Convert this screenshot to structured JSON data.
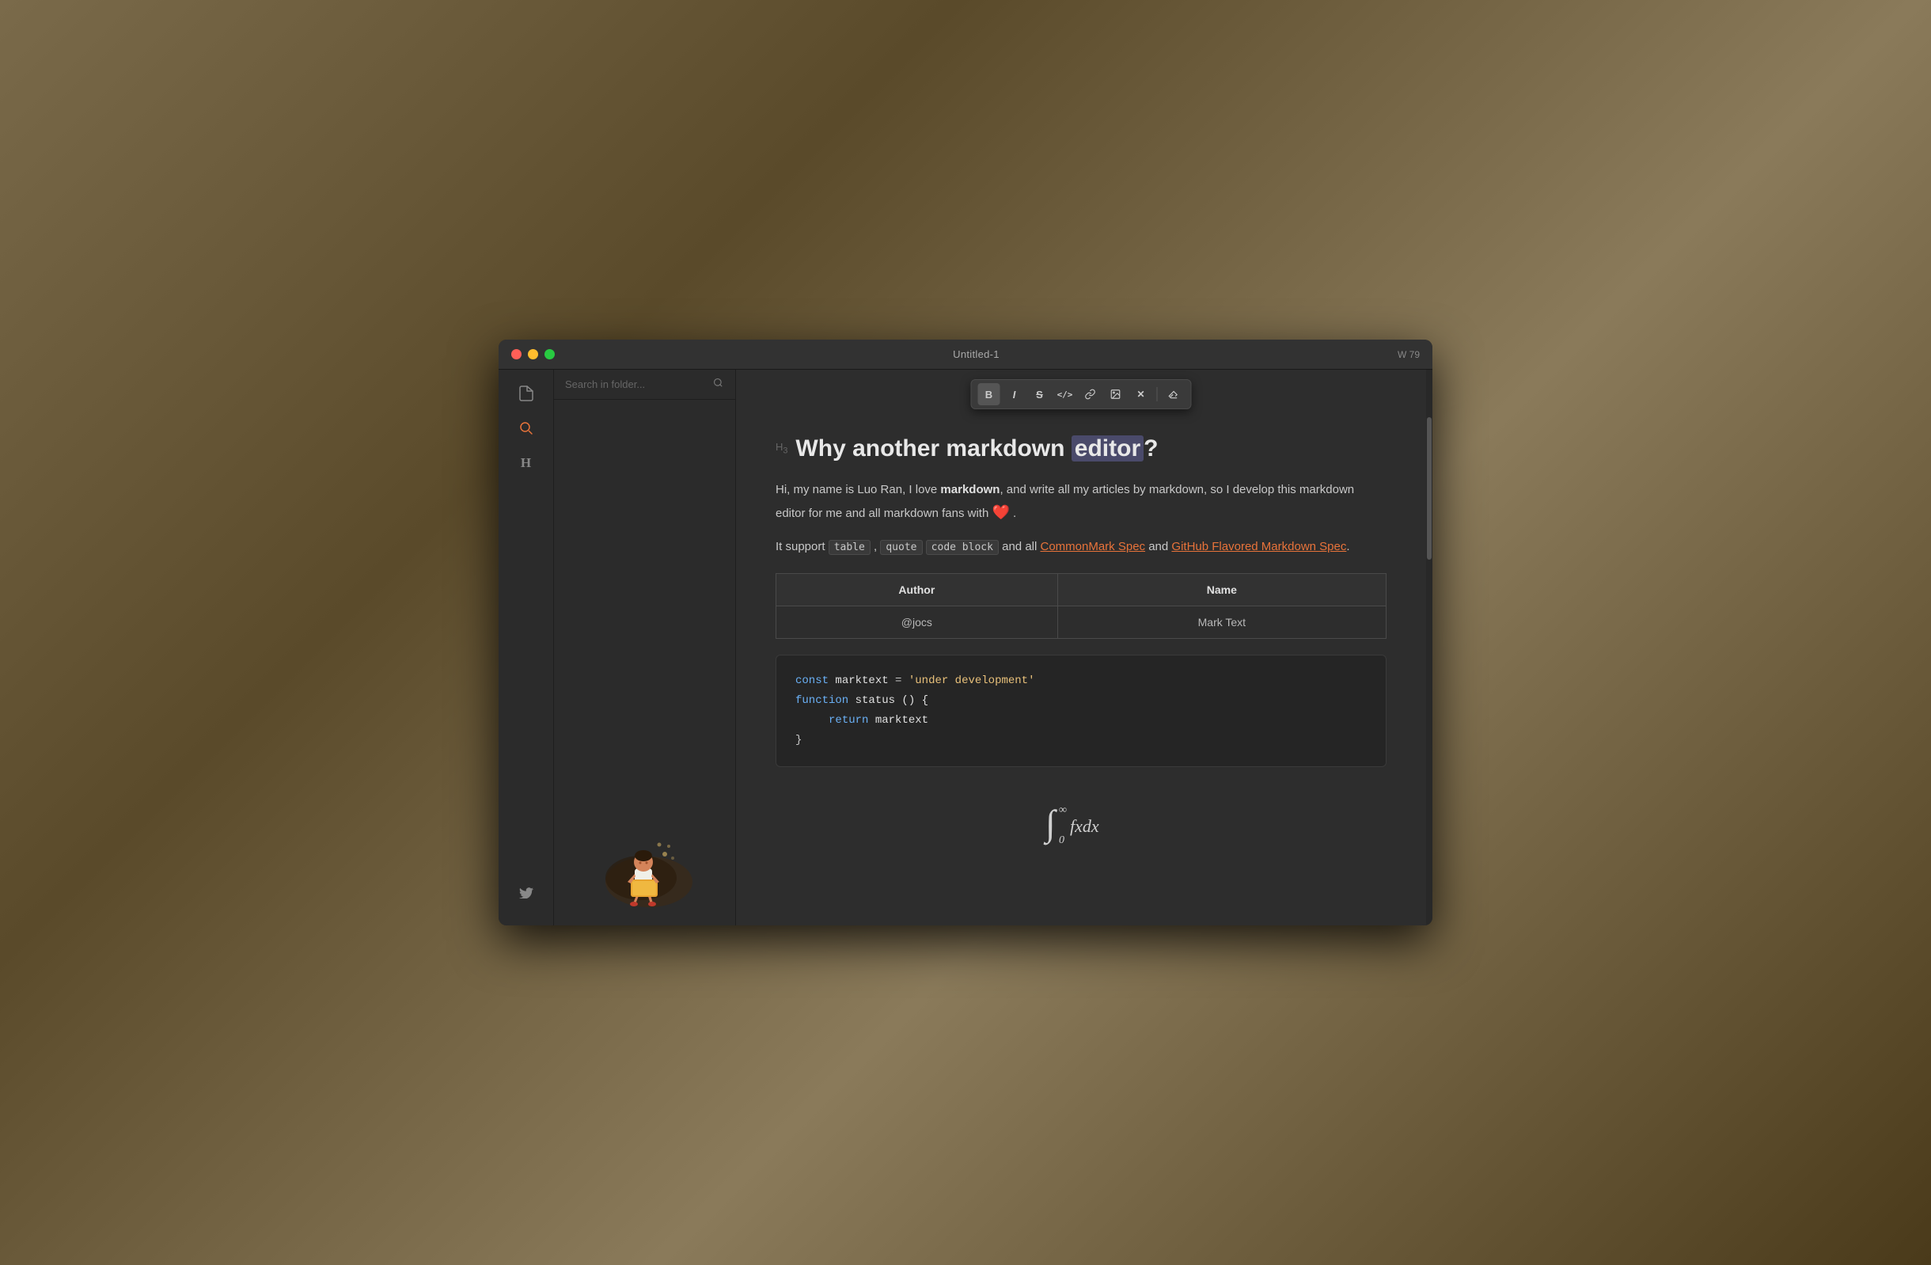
{
  "window": {
    "title": "Untitled-1",
    "word_count_label": "W 79"
  },
  "traffic_lights": {
    "red": "close",
    "yellow": "minimize",
    "green": "maximize"
  },
  "sidebar": {
    "icons": [
      {
        "name": "file-icon",
        "symbol": "📄",
        "active": false
      },
      {
        "name": "search-icon",
        "symbol": "🔍",
        "active": true
      },
      {
        "name": "heading-icon",
        "symbol": "H",
        "active": false
      }
    ],
    "bottom_icon": {
      "name": "twitter-icon",
      "symbol": "🐦"
    }
  },
  "file_panel": {
    "search_placeholder": "Search in folder..."
  },
  "toolbar": {
    "buttons": [
      {
        "label": "B",
        "name": "bold-btn",
        "active": false
      },
      {
        "label": "I",
        "name": "italic-btn",
        "active": false
      },
      {
        "label": "S̶",
        "name": "strikethrough-btn",
        "active": false
      },
      {
        "label": "</>",
        "name": "code-btn",
        "active": false
      },
      {
        "label": "🔗",
        "name": "link-btn",
        "active": false
      },
      {
        "label": "🖼",
        "name": "image-btn",
        "active": false
      },
      {
        "label": "✕",
        "name": "clear-btn",
        "active": false
      },
      {
        "label": "✏",
        "name": "erase-btn",
        "active": false
      }
    ]
  },
  "editor": {
    "heading_level": "H3",
    "heading_text": "Why another markdown editor?",
    "heading_highlight_word": "editor",
    "paragraphs": [
      {
        "id": "p1",
        "text_parts": [
          {
            "type": "text",
            "content": "Hi, my name is Luo Ran, I love "
          },
          {
            "type": "bold",
            "content": "markdown"
          },
          {
            "type": "text",
            "content": ", and write all my articles by markdown, so I develop this markdown editor for me and all markdown fans with "
          },
          {
            "type": "emoji",
            "content": "❤️"
          },
          {
            "type": "text",
            "content": " ."
          }
        ]
      },
      {
        "id": "p2",
        "text_parts": [
          {
            "type": "text",
            "content": "It support "
          },
          {
            "type": "code",
            "content": "table"
          },
          {
            "type": "text",
            "content": " , "
          },
          {
            "type": "code",
            "content": "quote"
          },
          {
            "type": "text",
            "content": " "
          },
          {
            "type": "code",
            "content": "code block"
          },
          {
            "type": "text",
            "content": " and all "
          },
          {
            "type": "link",
            "content": "CommonMark Spec"
          },
          {
            "type": "text",
            "content": " and "
          },
          {
            "type": "link",
            "content": "GitHub Flavored Markdown Spec"
          },
          {
            "type": "text",
            "content": "."
          }
        ]
      }
    ],
    "table": {
      "headers": [
        "Author",
        "Name"
      ],
      "rows": [
        [
          "@jocs",
          "Mark Text"
        ]
      ]
    },
    "code_block": {
      "lines": [
        {
          "parts": [
            {
              "type": "kw",
              "text": "const"
            },
            {
              "type": "var",
              "text": " marktext "
            },
            {
              "type": "punct",
              "text": "="
            },
            {
              "type": "str",
              "text": " 'under development'"
            }
          ]
        },
        {
          "parts": [
            {
              "type": "kw",
              "text": "function"
            },
            {
              "type": "var",
              "text": " status () {"
            },
            {
              "type": "punct",
              "text": ""
            }
          ]
        },
        {
          "parts": [
            {
              "type": "indent",
              "text": "    "
            },
            {
              "type": "kw",
              "text": "return"
            },
            {
              "type": "var",
              "text": " marktext"
            }
          ]
        },
        {
          "parts": [
            {
              "type": "punct",
              "text": "}"
            }
          ]
        }
      ]
    },
    "math": {
      "formula": "∫₀^∞ fxdx"
    }
  }
}
